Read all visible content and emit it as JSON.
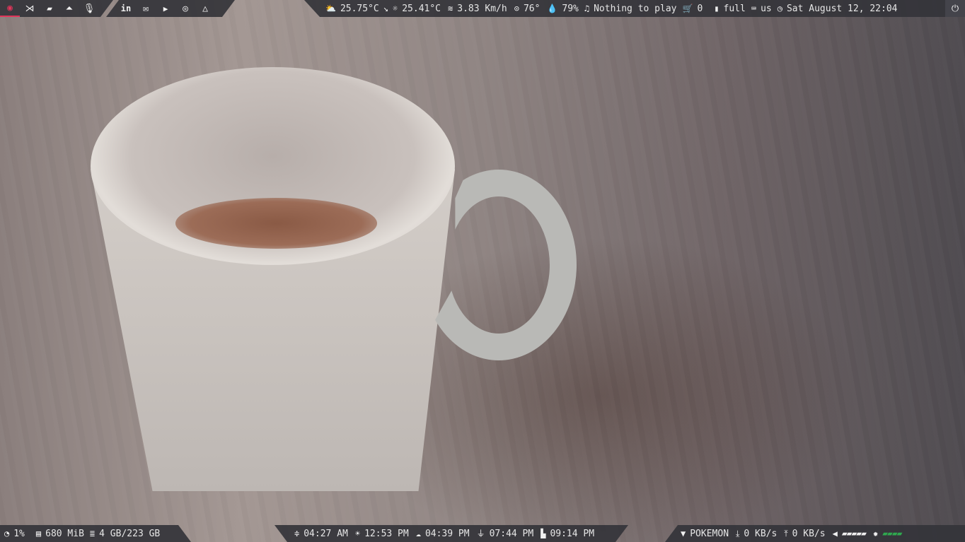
{
  "top_left": {
    "launchers": [
      {
        "icon": "app-menu-icon",
        "glyph": "◉"
      },
      {
        "icon": "vscode-icon",
        "glyph": "⋊"
      },
      {
        "icon": "folder-icon",
        "glyph": "▰"
      },
      {
        "icon": "vlc-icon",
        "glyph": "⏶"
      },
      {
        "icon": "microphone-icon",
        "glyph": "🎙"
      }
    ],
    "links": [
      {
        "icon": "linkedin-icon",
        "glyph": "in"
      },
      {
        "icon": "mail-icon",
        "glyph": "✉"
      },
      {
        "icon": "youtube-icon",
        "glyph": "▶"
      },
      {
        "icon": "discord-icon",
        "glyph": "◎"
      },
      {
        "icon": "drive-icon",
        "glyph": "△"
      }
    ]
  },
  "top_right": {
    "weather_temp": "25.75°C",
    "trend_glyph": "↘",
    "feels_temp": "25.41°C",
    "wind": "3.83 Km/h",
    "direction": "76°",
    "humidity": "79%",
    "player": "Nothing to play",
    "updates": "0",
    "battery": "full",
    "keyboard": "us",
    "datetime": "Sat August 12, 22:04"
  },
  "bottom_left": {
    "cpu": "1%",
    "memory": "680 MiB",
    "disk": "4 GB/223 GB"
  },
  "bottom_center": {
    "dawn": "04:27 AM",
    "sunrise": "12:53 PM",
    "sunset": "04:39 PM",
    "dusk": "07:44 PM",
    "bedtime": "09:14 PM"
  },
  "bottom_right": {
    "wifi": "POKEMON",
    "down": "0 KB/s",
    "up": "0 KB/s",
    "volume_bars": "▰▰▰▰▰",
    "brightness_bars": "▰▰▰▰"
  },
  "colors": {
    "accent": "#e0355a",
    "bar": "#34343a",
    "green": "#2fa84f"
  }
}
